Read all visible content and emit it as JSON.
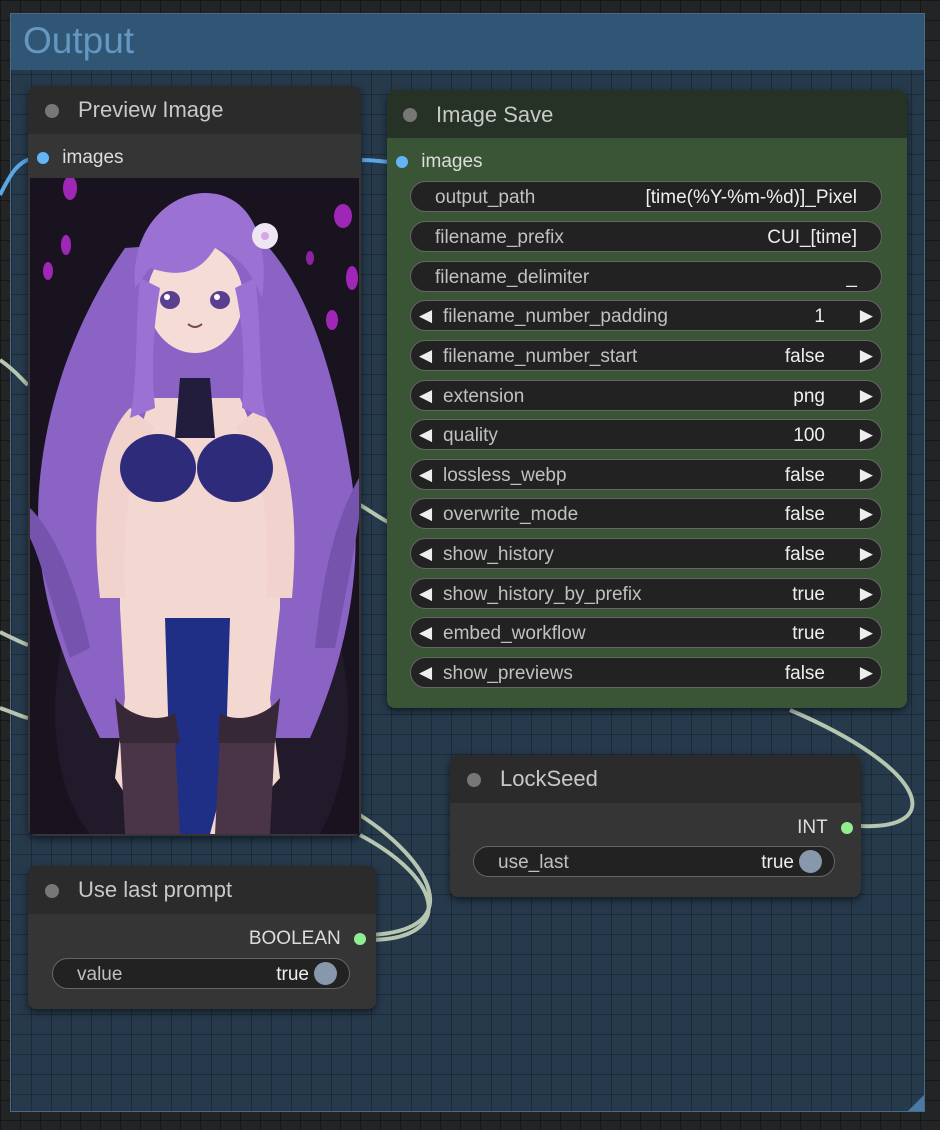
{
  "group": {
    "title": "Output",
    "color": "#335a7a"
  },
  "preview_node": {
    "title": "Preview Image",
    "input_label": "images",
    "image_desc": "pixel-art anime girl with long purple hair in a dark blue outfit, purple petals on dark background"
  },
  "save_node": {
    "title": "Image Save",
    "input_label": "images",
    "widgets": [
      {
        "name": "output_path",
        "value": "[time(%Y-%m-%d)]_Pixel",
        "type": "text"
      },
      {
        "name": "filename_prefix",
        "value": "CUI_[time]",
        "type": "text"
      },
      {
        "name": "filename_delimiter",
        "value": "_",
        "type": "text"
      },
      {
        "name": "filename_number_padding",
        "value": "1",
        "type": "combo"
      },
      {
        "name": "filename_number_start",
        "value": "false",
        "type": "combo"
      },
      {
        "name": "extension",
        "value": "png",
        "type": "combo"
      },
      {
        "name": "quality",
        "value": "100",
        "type": "combo"
      },
      {
        "name": "lossless_webp",
        "value": "false",
        "type": "combo"
      },
      {
        "name": "overwrite_mode",
        "value": "false",
        "type": "combo"
      },
      {
        "name": "show_history",
        "value": "false",
        "type": "combo"
      },
      {
        "name": "show_history_by_prefix",
        "value": "true",
        "type": "combo"
      },
      {
        "name": "embed_workflow",
        "value": "true",
        "type": "combo"
      },
      {
        "name": "show_previews",
        "value": "false",
        "type": "combo"
      }
    ]
  },
  "lockseed_node": {
    "title": "LockSeed",
    "output_label": "INT",
    "widget": {
      "name": "use_last",
      "value": "true"
    }
  },
  "lastprompt_node": {
    "title": "Use last prompt",
    "output_label": "BOOLEAN",
    "widget": {
      "name": "value",
      "value": "true"
    }
  },
  "colors": {
    "image_slot": "#64b5f6",
    "boolean_slot": "#90ee90",
    "int_slot": "#90ee90",
    "save_title_bg": "#263226",
    "save_body_bg": "#3a5536",
    "link_light": "#b6c6b0",
    "link_image": "#5aa7e8"
  }
}
